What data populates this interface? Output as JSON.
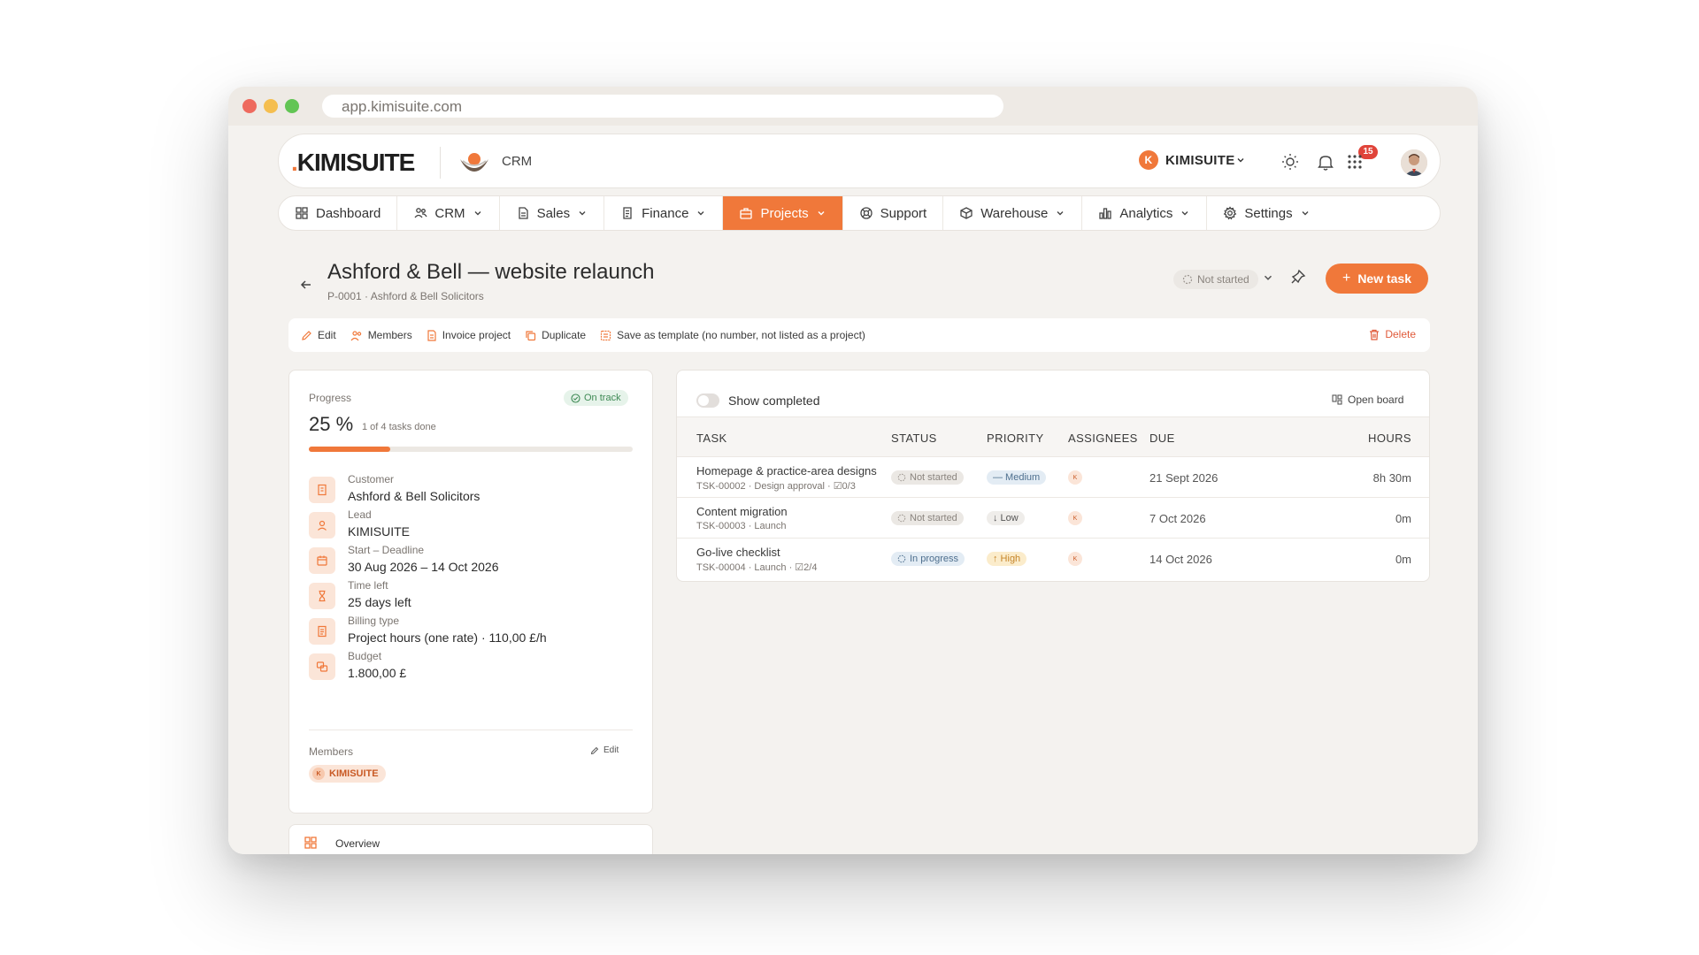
{
  "browser": {
    "url": "app.kimisuite.com"
  },
  "header": {
    "logo_text": "KIMISUITE",
    "app_label": "CRM",
    "company_name": "KIMISUITE",
    "company_initial": "K",
    "notification_count": "15"
  },
  "nav": {
    "items": [
      {
        "label": "Dashboard",
        "icon": "grid-icon"
      },
      {
        "label": "CRM",
        "icon": "users-icon"
      },
      {
        "label": "Sales",
        "icon": "document-icon"
      },
      {
        "label": "Finance",
        "icon": "invoice-icon"
      },
      {
        "label": "Projects",
        "icon": "briefcase-icon",
        "active": true
      },
      {
        "label": "Support",
        "icon": "lifebuoy-icon"
      },
      {
        "label": "Warehouse",
        "icon": "box-icon"
      },
      {
        "label": "Analytics",
        "icon": "bar-chart-icon"
      },
      {
        "label": "Settings",
        "icon": "gear-icon"
      }
    ]
  },
  "project": {
    "title": "Ashford & Bell — website relaunch",
    "subtitle": "P-0001 · Ashford & Bell Solicitors",
    "status": "Not started",
    "new_task_label": "New task"
  },
  "actions": {
    "edit": "Edit",
    "members": "Members",
    "invoice": "Invoice project",
    "duplicate": "Duplicate",
    "save_template": "Save as template (no number, not listed as a project)",
    "delete": "Delete"
  },
  "summary": {
    "progress_label": "Progress",
    "health": "On track",
    "percent_text": "25 %",
    "progress_fraction": 0.25,
    "tasks_done": "1 of 4 tasks done",
    "fields": [
      {
        "label": "Customer",
        "value": "Ashford & Bell Solicitors",
        "icon": "building-icon"
      },
      {
        "label": "Lead",
        "value": "KIMISUITE",
        "icon": "user-icon"
      },
      {
        "label": "Start – Deadline",
        "value": "30 Aug 2026 – 14 Oct 2026",
        "icon": "calendar-icon"
      },
      {
        "label": "Time left",
        "value": "25 days left",
        "icon": "hourglass-icon"
      },
      {
        "label": "Billing type",
        "value": "Project hours (one rate) · 110,00 £/h",
        "icon": "receipt-icon"
      },
      {
        "label": "Budget",
        "value": "1.800,00 £",
        "icon": "coins-icon"
      }
    ],
    "members_label": "Members",
    "members_edit": "Edit",
    "member_initial": "K",
    "member_name": "KIMISUITE"
  },
  "overview": {
    "label": "Overview"
  },
  "tasks": {
    "show_completed": "Show completed",
    "open_board": "Open board",
    "columns": {
      "task": "TASK",
      "status": "STATUS",
      "priority": "PRIORITY",
      "assignees": "ASSIGNEES",
      "due": "DUE",
      "hours": "HOURS"
    },
    "rows": [
      {
        "name": "Homepage & practice-area designs",
        "meta": "TSK-00002 · Design approval · ☑0/3",
        "status": "Not started",
        "priority": "— Medium",
        "assignee": "K",
        "due": "21 Sept 2026",
        "hours": "8h 30m"
      },
      {
        "name": "Content migration",
        "meta": "TSK-00003 · Launch",
        "status": "Not started",
        "priority": "↓ Low",
        "assignee": "K",
        "due": "7 Oct 2026",
        "hours": "0m"
      },
      {
        "name": "Go-live checklist",
        "meta": "TSK-00004 · Launch · ☑2/4",
        "status": "In progress",
        "priority": "↑ High",
        "assignee": "K",
        "due": "14 Oct 2026",
        "hours": "0m"
      }
    ]
  },
  "colors": {
    "accent": "#f0783a",
    "success": "#3f8a55",
    "danger": "#e05a3a"
  }
}
